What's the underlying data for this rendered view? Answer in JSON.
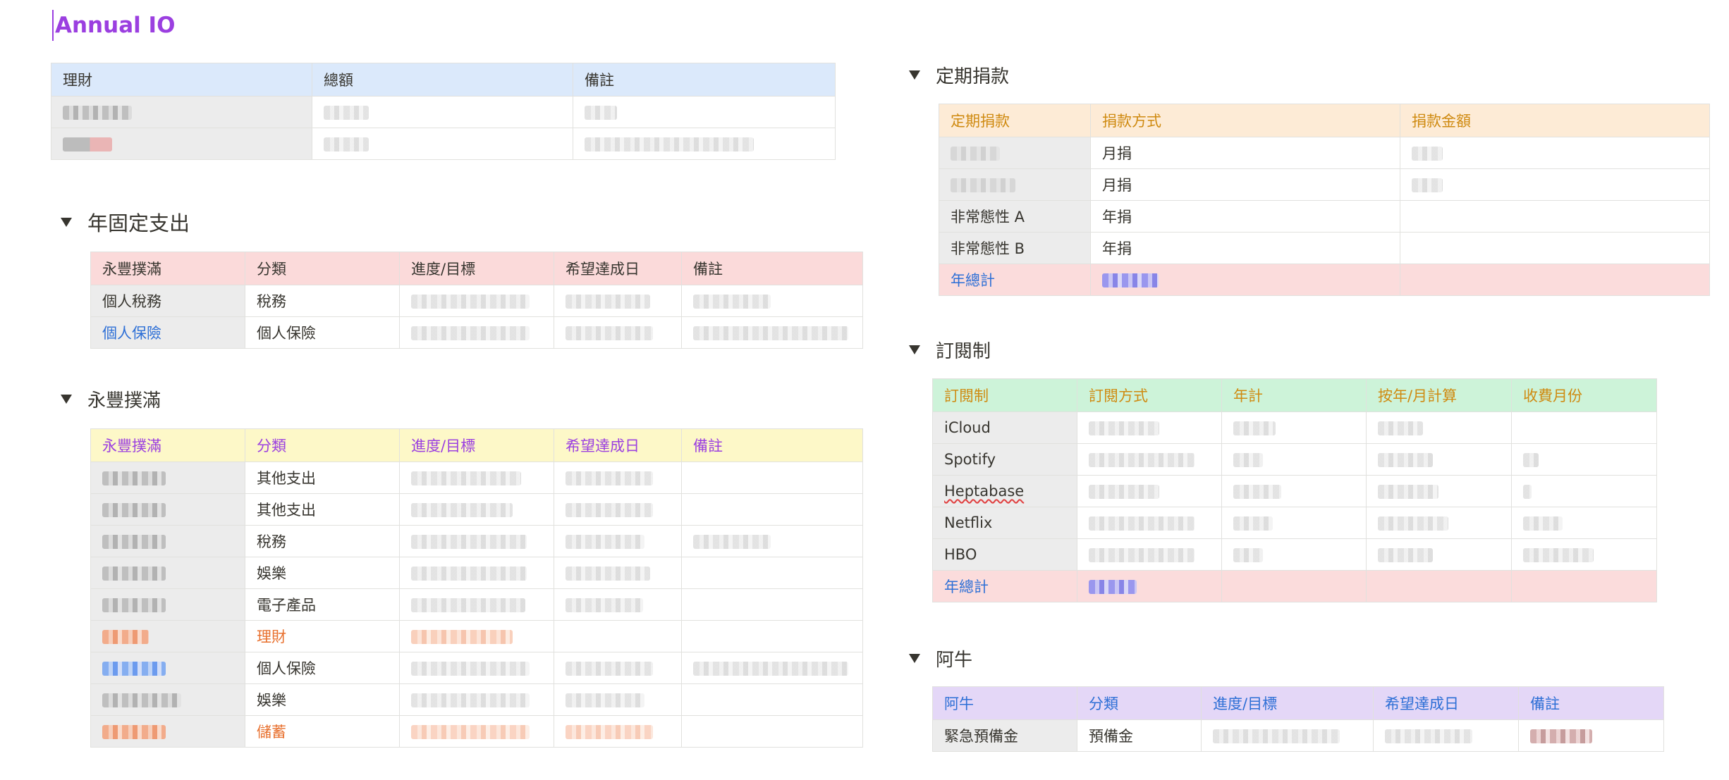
{
  "page": {
    "title": "Annual IO"
  },
  "colors": {
    "accent": "#9b3fe0",
    "link_blue": "#2d6fd6",
    "orange": "#e8702e",
    "gold": "#cf8a10"
  },
  "invest": {
    "headers": [
      "理財",
      "總額",
      "備註"
    ]
  },
  "fixed": {
    "toggle": "年固定支出",
    "headers": [
      "永豐撲滿",
      "分類",
      "進度/目標",
      "希望達成日",
      "備註"
    ],
    "rows": [
      {
        "name": "個人稅務",
        "category": "稅務"
      },
      {
        "name": "個人保險",
        "category": "個人保險"
      }
    ]
  },
  "piggy": {
    "toggle": "永豐撲滿",
    "headers": [
      "永豐撲滿",
      "分類",
      "進度/目標",
      "希望達成日",
      "備註"
    ],
    "categories": [
      "其他支出",
      "其他支出",
      "稅務",
      "娛樂",
      "電子產品",
      "理財",
      "個人保險",
      "娛樂",
      "儲蓄"
    ]
  },
  "donation": {
    "toggle": "定期捐款",
    "headers": [
      "定期捐款",
      "捐款方式",
      "捐款金額"
    ],
    "rows": [
      {
        "name": "",
        "method": "月捐"
      },
      {
        "name": "",
        "method": "月捐"
      },
      {
        "name": "非常態性 A",
        "method": "年捐"
      },
      {
        "name": "非常態性 B",
        "method": "年捐"
      }
    ],
    "total_label": "年總計"
  },
  "subs": {
    "toggle": "訂閱制",
    "headers": [
      "訂閱制",
      "訂閱方式",
      "年計",
      "按年/月計算",
      "收費月份"
    ],
    "rows": [
      "iCloud",
      "Spotify",
      "Heptabase",
      "Netflix",
      "HBO"
    ],
    "total_label": "年總計"
  },
  "aniu": {
    "toggle": "阿牛",
    "headers": [
      "阿牛",
      "分類",
      "進度/目標",
      "希望達成日",
      "備註"
    ],
    "rows": [
      {
        "name": "緊急預備金",
        "category": "預備金"
      }
    ]
  }
}
